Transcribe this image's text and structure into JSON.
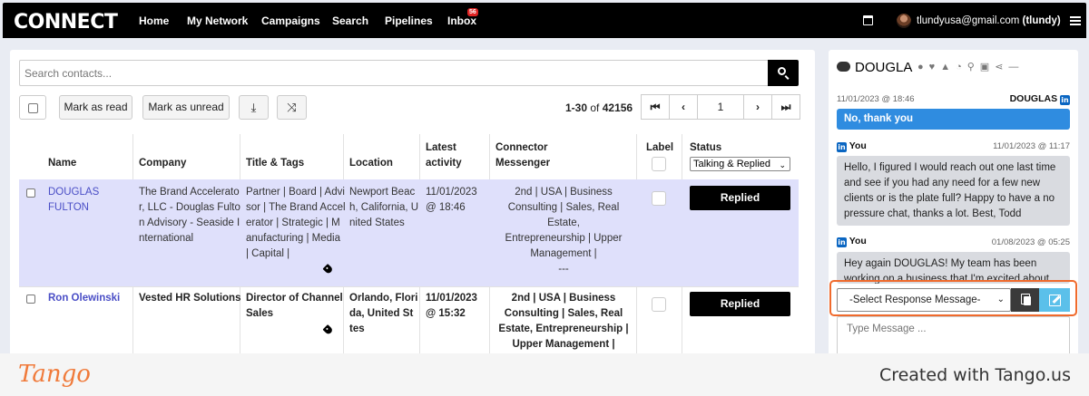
{
  "nav": {
    "logo": "CONNECT",
    "items": [
      "Home",
      "My Network",
      "Campaigns",
      "Search",
      "Pipelines",
      "Inbox"
    ],
    "inbox_badge": "56",
    "user_email": "tlundyusa@gmail.com",
    "user_handle": "(tlundy)"
  },
  "search": {
    "placeholder": "Search contacts..."
  },
  "toolbar": {
    "mark_read": "Mark as read",
    "mark_unread": "Mark as unread",
    "range_prefix": "1-30",
    "range_of": "of",
    "range_total": "42156",
    "page": "1"
  },
  "table": {
    "headers": {
      "name": "Name",
      "company": "Company",
      "title": "Title & Tags",
      "location": "Location",
      "latest_1": "Latest",
      "latest_2": "activity",
      "connector_1": "Connector",
      "connector_2": "Messenger",
      "label": "Label",
      "status": "Status"
    },
    "status_filter": "Talking & Replied",
    "rows": [
      {
        "name_1": "DOUGLAS",
        "name_2": "FULTON",
        "company": [
          "The Brand Accelerato",
          "r, LLC - Douglas Fulto",
          "n Advisory - Seaside I",
          "nternational"
        ],
        "title": [
          "Partner | Board | Advi",
          "sor | The Brand Accel",
          "erator | Strategic | M",
          "anufacturing | Media",
          "| Capital |"
        ],
        "location": [
          "Newport Beac",
          "h, California, U",
          "nited States"
        ],
        "latest_1": "11/01/2023",
        "latest_2": "@ 18:46",
        "connector": [
          "2nd | USA | Business",
          "Consulting | Sales, Real Estate,",
          "Entrepreneurship | Upper",
          "Management |",
          "---"
        ],
        "status": "Replied"
      },
      {
        "name_1": "Ron Olewinski",
        "company": [
          "Vested HR Solutions"
        ],
        "title": [
          "Director of Channel",
          "Sales"
        ],
        "location": [
          "Orlando, Flori",
          "da, United St",
          "tes"
        ],
        "latest_1": "11/01/2023",
        "latest_2": "@ 15:32",
        "connector": [
          "2nd | USA | Business",
          "Consulting | Sales, Real",
          "Estate, Entrepreneurship |",
          "Upper Management |"
        ],
        "status": "Replied"
      }
    ]
  },
  "side": {
    "title": "DOUGLA",
    "messages": [
      {
        "date": "11/01/2023 @ 18:46",
        "author": "DOUGLAS",
        "text": "No, thank you"
      },
      {
        "author": "You",
        "date": "11/01/2023 @ 11:17",
        "text": "Hello, I figured I would reach out one last time and see if you had any need for a few new clients or is the plate full? Happy to have a no pressure chat, thanks a lot. Best, Todd"
      },
      {
        "author": "You",
        "date": "01/08/2023 @ 05:25",
        "text": "Hey again DOUGLAS! My team has been working on a business that I'm excited about within"
      }
    ],
    "response_select": "-Select Response Message-",
    "message_placeholder": "Type Message ..."
  },
  "footer": {
    "logo": "Tango",
    "created": "Created with Tango.us"
  },
  "colors": {
    "nav_bg": "#000000",
    "selected_row": "#dfe0fb",
    "link": "#4a4ec6",
    "accent_blue": "#2f8ce0",
    "highlight": "#f06a2c",
    "tango": "#f07a3a"
  }
}
